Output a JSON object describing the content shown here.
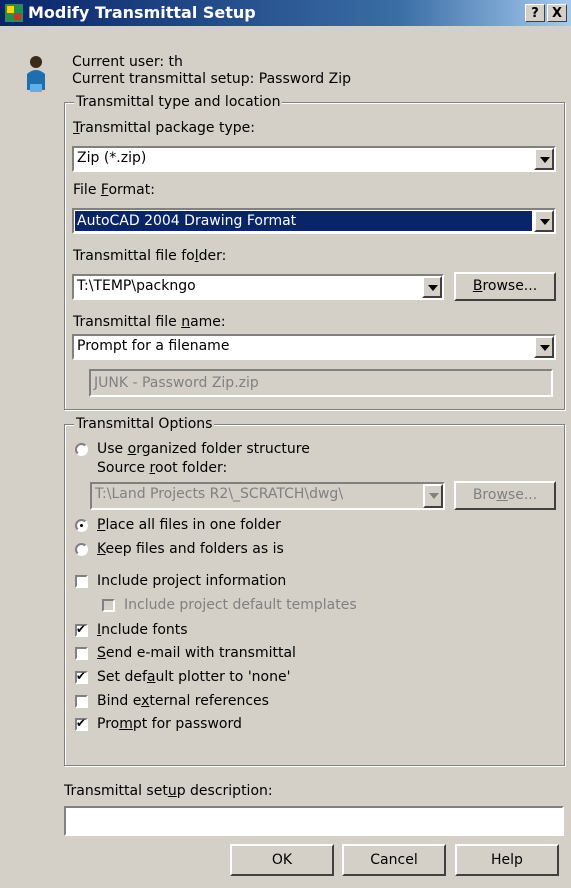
{
  "window": {
    "title": "Modify Transmittal Setup",
    "help_label": "?",
    "close_label": "X"
  },
  "header": {
    "current_user": "Current user: th",
    "current_setup": "Current transmittal setup: Password Zip"
  },
  "type_group": {
    "legend": "Transmittal type and location",
    "package_type_label": "Transmittal package type:",
    "package_type_value": "Zip (*.zip)",
    "file_format_label": "File Format:",
    "file_format_value": "AutoCAD 2004 Drawing Format",
    "folder_label": "Transmittal file folder:",
    "folder_value": "T:\\TEMP\\packngo",
    "browse_label": "Browse...",
    "filename_label": "Transmittal file name:",
    "filename_value": "Prompt for a filename",
    "filename_preview": "JUNK - Password Zip.zip"
  },
  "options_group": {
    "legend": "Transmittal Options",
    "radio_organized": "Use organized folder structure",
    "source_root_label": "Source root folder:",
    "source_root_value": "T:\\Land Projects R2\\_SCRATCH\\dwg\\",
    "browse_label": "Browse...",
    "radio_one_folder": "Place all files in one folder",
    "radio_keep": "Keep files and folders as is",
    "selected_radio": "Place all files in one folder",
    "checks": [
      {
        "label": "Include project information",
        "checked": false
      },
      {
        "label": "Include project default templates",
        "checked": false,
        "disabled": true
      },
      {
        "label": "Include fonts",
        "checked": true
      },
      {
        "label": "Send e-mail with transmittal",
        "checked": false
      },
      {
        "label": "Set default plotter to 'none'",
        "checked": true
      },
      {
        "label": "Bind external references",
        "checked": false
      },
      {
        "label": "Prompt for password",
        "checked": true
      }
    ]
  },
  "description": {
    "label": "Transmittal setup description:",
    "value": ""
  },
  "buttons": {
    "ok": "OK",
    "cancel": "Cancel",
    "help": "Help"
  }
}
